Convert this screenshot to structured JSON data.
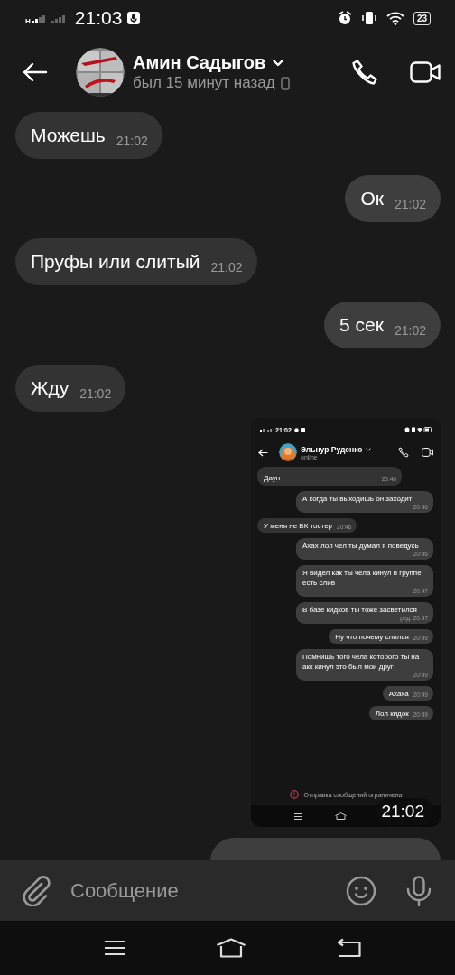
{
  "status_bar": {
    "network_label": "H",
    "time": "21:03",
    "battery": "23"
  },
  "header": {
    "name": "Амин Садыгов",
    "status": "был 15 минут назад"
  },
  "messages": [
    {
      "kind": "incoming",
      "text": "Можешь",
      "time": "21:02"
    },
    {
      "kind": "outgoing",
      "text": "Ок",
      "time": "21:02"
    },
    {
      "kind": "incoming",
      "text": "Пруфы или слитый",
      "time": "21:02"
    },
    {
      "kind": "outgoing",
      "text": "5 сек",
      "time": "21:02"
    },
    {
      "kind": "incoming",
      "text": "Жду",
      "time": "21:02"
    }
  ],
  "shared_screenshot": {
    "status_time": "21:02",
    "contact_name": "Эльнур Руденко",
    "contact_status": "online",
    "messages": [
      {
        "kind": "incoming",
        "text": "Даун",
        "time": "20:46"
      },
      {
        "kind": "outgoing",
        "text": "А когда ты выходишь он заходит",
        "time": "20:46"
      },
      {
        "kind": "incoming",
        "text": "У меня не ВК тостер",
        "time": "20:46"
      },
      {
        "kind": "outgoing",
        "text": "Ахах лол чел ты думал я поведусь",
        "time": "20:46"
      },
      {
        "kind": "outgoing",
        "text": "Я видел как ты чела кинул в группе есть слив",
        "time": "20:47"
      },
      {
        "kind": "outgoing",
        "text": "В базе кидков ты тоже засветился",
        "time": "ред. 20:47"
      },
      {
        "kind": "outgoing",
        "text": "Ну что почему слился",
        "time": "20:49"
      },
      {
        "kind": "outgoing",
        "text": "Помнишь того чела которого ты на акк кинул это был мои друг",
        "time": "20:49"
      },
      {
        "kind": "outgoing",
        "text": "Ахаха",
        "time": "20:49"
      },
      {
        "kind": "outgoing",
        "text": "Лол кидок",
        "time": "20:49"
      }
    ],
    "notice": "Отправка сообщений ограничена",
    "time_badge": "21:02"
  },
  "partial_message": {
    "kind": "outgoing"
  },
  "composer": {
    "placeholder": "Сообщение"
  }
}
